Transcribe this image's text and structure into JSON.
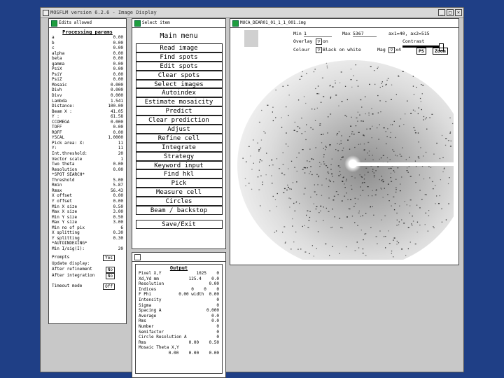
{
  "window": {
    "title": "MOSFLM version 6.2.6 - Image Display",
    "buttons": [
      "_",
      "□",
      "×"
    ]
  },
  "processing": {
    "header": "Edits allowed",
    "title": "Processing params",
    "rows": [
      [
        "a",
        "0.00"
      ],
      [
        "b",
        "0.00"
      ],
      [
        "c",
        "0.00"
      ],
      [
        "alpha",
        "0.00"
      ],
      [
        "beta",
        "0.00"
      ],
      [
        "gamma",
        "0.00"
      ],
      [
        "PsiX",
        "0.00"
      ],
      [
        "PsiY",
        "0.00"
      ],
      [
        "PsiZ",
        "0.00"
      ],
      [
        "Mosaic",
        "0.000"
      ],
      [
        "Divh",
        "0.000"
      ],
      [
        "Divv",
        "0.000"
      ],
      [
        "Lambda",
        "1.541"
      ],
      [
        "Distance:",
        "100.00"
      ],
      [
        "Beam X :",
        "41.05"
      ],
      [
        "Y :",
        "61.58"
      ],
      [
        "CCOMEGA",
        "0.000"
      ],
      [
        "TOFF",
        "0.00"
      ],
      [
        "ROFF",
        "0.00"
      ],
      [
        "YSCAL",
        "1.0000"
      ],
      [
        "Pick area: X:",
        "11"
      ],
      [
        "Y:",
        "11"
      ],
      [
        "Int.threshold:",
        "20"
      ],
      [
        "Vector scale",
        "1"
      ],
      [
        "Two theta",
        "0.00"
      ],
      [
        "Resolution",
        "0.00"
      ],
      [
        "*SPOT SEARCH*",
        ""
      ],
      [
        "Threshold",
        "5.00"
      ],
      [
        "Rmin",
        "5.87"
      ],
      [
        "Rmax",
        "56.43"
      ],
      [
        "X offset",
        "0.00"
      ],
      [
        "Y offset",
        "0.00"
      ],
      [
        "Min X size",
        "0.50"
      ],
      [
        "Max X size",
        "3.00"
      ],
      [
        "Min Y size",
        "0.50"
      ],
      [
        "Max Y size",
        "3.00"
      ],
      [
        "Min no of pix",
        "6"
      ],
      [
        "X splitting",
        "0.30"
      ],
      [
        "Y splitting",
        "0.30"
      ],
      [
        "*AUTOINDEXING*",
        ""
      ],
      [
        "Min I/sig(I):",
        "20"
      ]
    ],
    "prompts_label": "Prompts",
    "prompts_value": "Yes",
    "update_label": "Update display:",
    "after_ref_label": "After refinement",
    "after_ref_value": "No",
    "after_int_label": "After integration",
    "after_int_value": "No",
    "timeout_label": "Timeout mode",
    "timeout_value": "Off"
  },
  "menu": {
    "header": "Select item",
    "title": "Main menu",
    "items": [
      "Read image",
      "Find spots",
      "Edit spots",
      "Clear spots",
      "Select images",
      "Autoindex",
      "Estimate mosaicity",
      "Predict",
      "Clear prediction",
      "Adjust",
      "Refine cell",
      "Integrate",
      "Strategy",
      "Keyword input",
      "Find hkl",
      "Pick",
      "Measure cell",
      "Circles",
      "Beam / backstop"
    ],
    "save_exit": "Save/Exit"
  },
  "output": {
    "title": "Output",
    "rows": [
      [
        "Pixel X,Y",
        "1025    0"
      ],
      [
        "Xd,Yd mm",
        "125.4    0.0"
      ],
      [
        "Resolution",
        "0.00"
      ],
      [
        "Indices",
        "0    0    0"
      ],
      [
        "F Phi",
        "0.00 width  0.00"
      ],
      [
        "Intensity",
        "0"
      ],
      [
        "Sigma",
        "0"
      ],
      [
        "",
        ""
      ],
      [
        "Spacing A",
        "0.000"
      ],
      [
        "Average",
        "0.0"
      ],
      [
        "Rms",
        "0.0"
      ],
      [
        "Number",
        "0"
      ],
      [
        "Semifactor",
        "0"
      ],
      [
        "Circle Resolution A",
        "0"
      ],
      [
        "Rms",
        "0.00    0.50"
      ],
      [
        "Mosaic Theta X,Y",
        ""
      ],
      [
        "",
        "0.00    0.00    0.00"
      ]
    ]
  },
  "image": {
    "header": "MUCA_DEAR01_01_1_1_001.img",
    "min_label": "Min",
    "min_value": "1",
    "max_label": "Max",
    "max_value": "5367",
    "coords": "ax1=40, ax2=515",
    "overlay_label": "Overlay",
    "overlay_value": "on",
    "contrast_label": "Contrast",
    "colour_label": "Colour",
    "colour_value": "Black on white",
    "mag_label": "Mag",
    "mag_value": "x4",
    "ps_label": "PS",
    "zoom_label": "Zoom"
  },
  "colors": {
    "background": "#1f3f86",
    "window": "#c8c8c8",
    "indicator": "#1e9e3e"
  }
}
